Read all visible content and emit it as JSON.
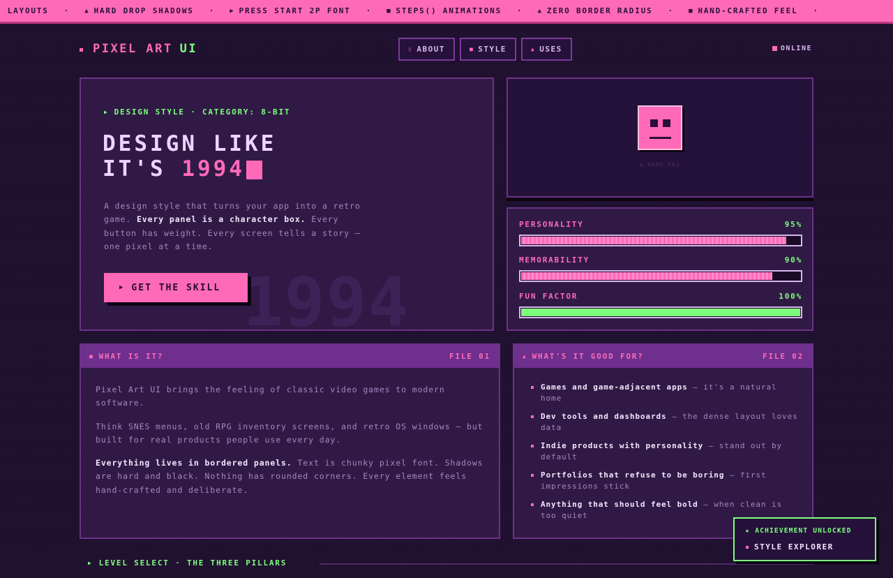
{
  "marquee": {
    "items": [
      {
        "icon": "",
        "text": "SED LAYOUTS"
      },
      {
        "icon": "triangle-up-icon",
        "glyph": "▲",
        "text": "HARD DROP SHADOWS"
      },
      {
        "icon": "play-icon",
        "glyph": "▶",
        "text": "PRESS START 2P FONT"
      },
      {
        "icon": "square-icon",
        "glyph": "■",
        "text": "STEPS() ANIMATIONS"
      },
      {
        "icon": "triangle-up-icon",
        "glyph": "▲",
        "text": "ZERO BORDER RADIUS"
      },
      {
        "icon": "square-icon",
        "glyph": "■",
        "text": "HAND-CRAFTED FEEL"
      }
    ],
    "separator": "·"
  },
  "header": {
    "logo_a": "PIXEL ART",
    "logo_b": "UI",
    "nav": [
      {
        "label": "ABOUT",
        "glyph": "▯"
      },
      {
        "label": "STYLE",
        "glyph": "■"
      },
      {
        "label": "USES",
        "glyph": "▲"
      }
    ],
    "status": "ONLINE"
  },
  "hero": {
    "eyebrow": "DESIGN STYLE · CATEGORY: 8-BIT",
    "title_line1": "DESIGN LIKE",
    "title_line2_a": "IT'S ",
    "title_line2_b": "1994",
    "desc_1": "A design style that turns your app into a retro game. ",
    "desc_bold": "Every panel is a character box.",
    "desc_2": " Every button has weight. Every screen tells a story — one pixel at a time.",
    "cta": "GET THE SKILL",
    "bg_year": "1994",
    "object_caption": "▪ HERO.OBJ"
  },
  "stats": [
    {
      "label": "PERSONALITY",
      "value": "95%",
      "fraction": 0.95,
      "color": "#ff6ab8"
    },
    {
      "label": "MEMORABILITY",
      "value": "90%",
      "fraction": 0.9,
      "color": "#ff6ab8"
    },
    {
      "label": "FUN FACTOR",
      "value": "100%",
      "fraction": 1.0,
      "color": "#7dff7d"
    }
  ],
  "panel1": {
    "title": "WHAT IS IT?",
    "file": "FILE 01",
    "p1": "Pixel Art UI brings the feeling of classic video games to modern software.",
    "p2": "Think SNES menus, old RPG inventory screens, and retro OS windows — but built for real products people use every day.",
    "p3_bold": "Everything lives in bordered panels.",
    "p3_rest": " Text is chunky pixel font. Shadows are hard and black. Nothing has rounded corners. Every element feels hand-crafted and deliberate."
  },
  "panel2": {
    "title": "WHAT'S IT GOOD FOR?",
    "file": "FILE 02",
    "items": [
      {
        "bold": "Games and game-adjacent apps",
        "rest": " — it's a natural home"
      },
      {
        "bold": "Dev tools and dashboards",
        "rest": " — the dense layout loves data"
      },
      {
        "bold": "Indie products with personality",
        "rest": " — stand out by default"
      },
      {
        "bold": "Portfolios that refuse to be boring",
        "rest": " — first impressions stick"
      },
      {
        "bold": "Anything that should feel bold",
        "rest": " — when clean is too quiet"
      }
    ]
  },
  "footer": {
    "level": "LEVEL SELECT · THE THREE PILLARS"
  },
  "toast": {
    "title": "ACHIEVEMENT UNLOCKED",
    "subtitle": "STYLE EXPLORER"
  },
  "colors": {
    "pink": "#ff6ab8",
    "green": "#7dff7d",
    "background": "#1f0f2e",
    "panel": "#301a45"
  }
}
